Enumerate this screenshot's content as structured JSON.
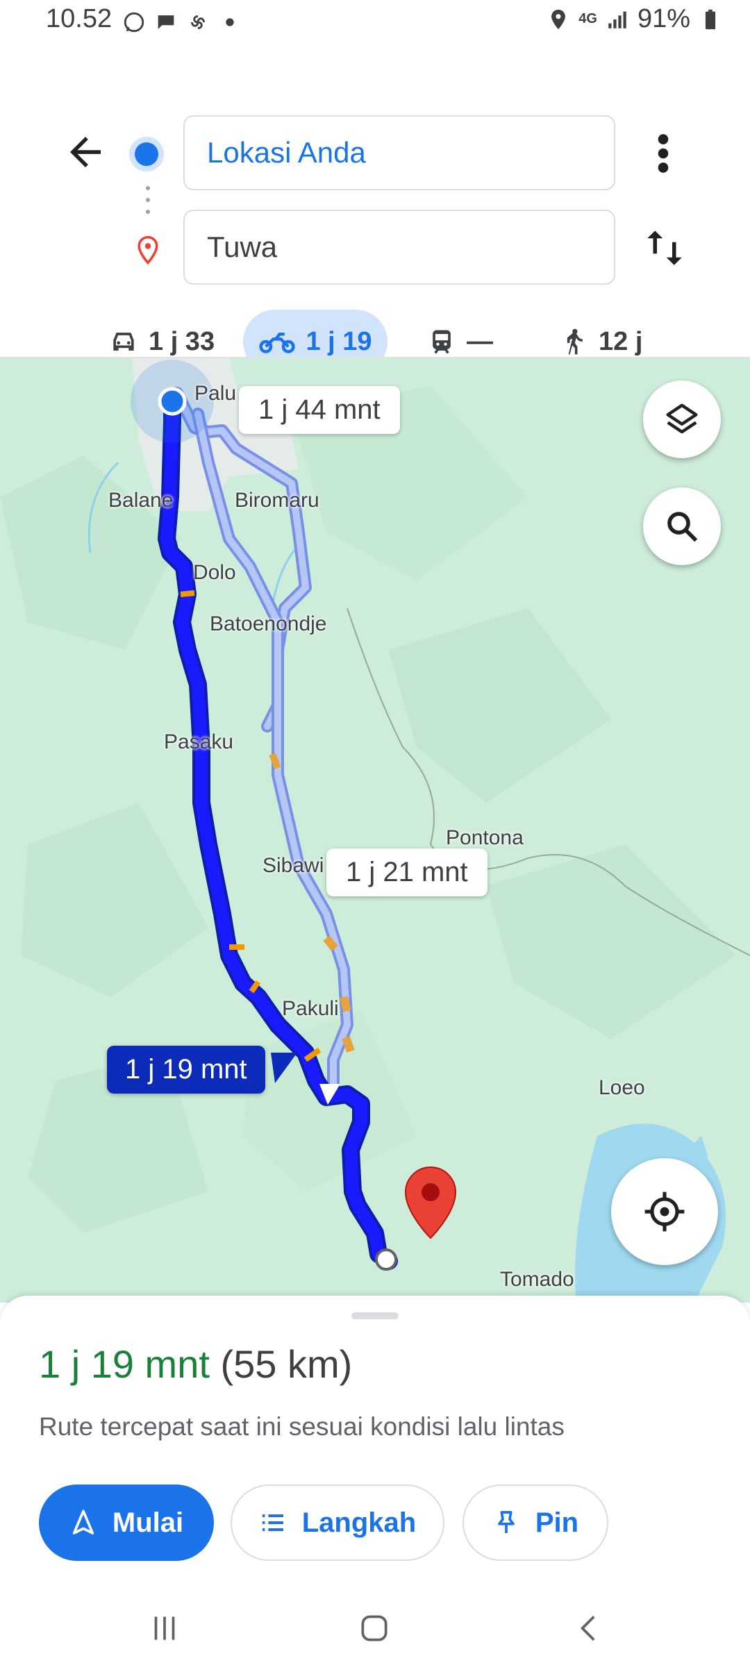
{
  "status_bar": {
    "time": "10.52",
    "network": "4G",
    "battery": "91%"
  },
  "directions": {
    "origin": "Lokasi Anda",
    "destination": "Tuwa"
  },
  "modes": [
    {
      "mode": "car",
      "label": "1 j 33"
    },
    {
      "mode": "motorcycle",
      "label": "1 j 19",
      "selected": true
    },
    {
      "mode": "transit",
      "label": "—"
    },
    {
      "mode": "walk",
      "label": "12 j"
    }
  ],
  "map": {
    "places": [
      "Palu",
      "Balane",
      "Biromaru",
      "Dolo",
      "Batoenondje",
      "Pasaku",
      "Pontona",
      "Sibawi",
      "Pakuli",
      "Loeo",
      "Tomado"
    ],
    "route_callouts": {
      "alt1": "1 j 44 mnt",
      "alt2": "1 j 21 mnt",
      "selected": "1 j 19 mnt"
    },
    "colors": {
      "selected_route": "#1a1aff",
      "alt_route": "#8fa6f2",
      "traffic_slow": "#f29900",
      "destination_pin": "#ea4335"
    }
  },
  "sheet": {
    "duration": "1 j 19 mnt",
    "distance": "(55 km)",
    "description": "Rute tercepat saat ini sesuai kondisi lalu lintas",
    "buttons": {
      "start": "Mulai",
      "steps": "Langkah",
      "pin": "Pin"
    }
  }
}
